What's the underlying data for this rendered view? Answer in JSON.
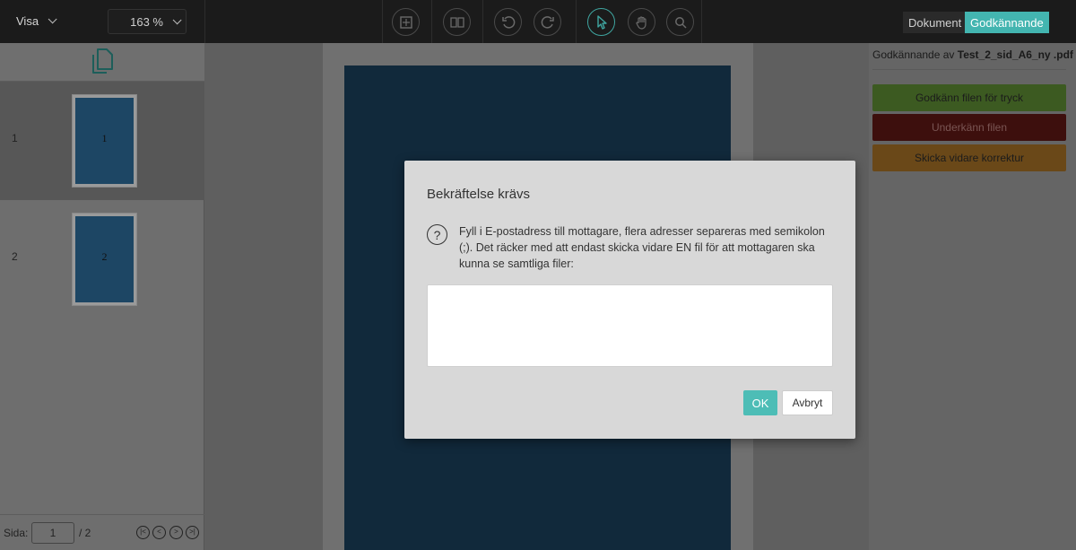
{
  "toolbar": {
    "view_label": "Visa",
    "zoom_value": "163 %",
    "icons": [
      "fit-page-icon",
      "book-view-icon",
      "rotate-left-icon",
      "rotate-right-icon",
      "select-cursor-icon",
      "pan-hand-icon",
      "search-icon"
    ],
    "tabs": {
      "document": "Dokument",
      "approval": "Godkännande"
    },
    "active_tab": "approval",
    "accent_color": "#43b5b0"
  },
  "thumbnails": {
    "header_icon": "documents-icon",
    "pages": [
      {
        "number": "1",
        "label": "1",
        "selected": true
      },
      {
        "number": "2",
        "label": "2",
        "selected": false
      }
    ]
  },
  "pager": {
    "label": "Sida:",
    "current_page": "1",
    "total": "/ 2"
  },
  "approval_panel": {
    "title_prefix": "Godkännande av",
    "file_name": "Test_2_sid_A6_ny .pdf",
    "approve_button": "Godkänn filen för tryck",
    "reject_button": "Underkänn filen",
    "forward_button": "Skicka vidare korrektur",
    "colors": {
      "approve": "#3c5a21",
      "reject": "#3d0f0d",
      "forward": "#6a4818"
    }
  },
  "dialog": {
    "title": "Bekräftelse krävs",
    "message": "Fyll i E-postadress till mottagare, flera adresser separeras med semikolon (;). Det räcker med att endast skicka vidare EN fil för att mottagaren ska kunna se samtliga filer:",
    "email_value": "",
    "ok_label": "OK",
    "cancel_label": "Avbryt"
  }
}
